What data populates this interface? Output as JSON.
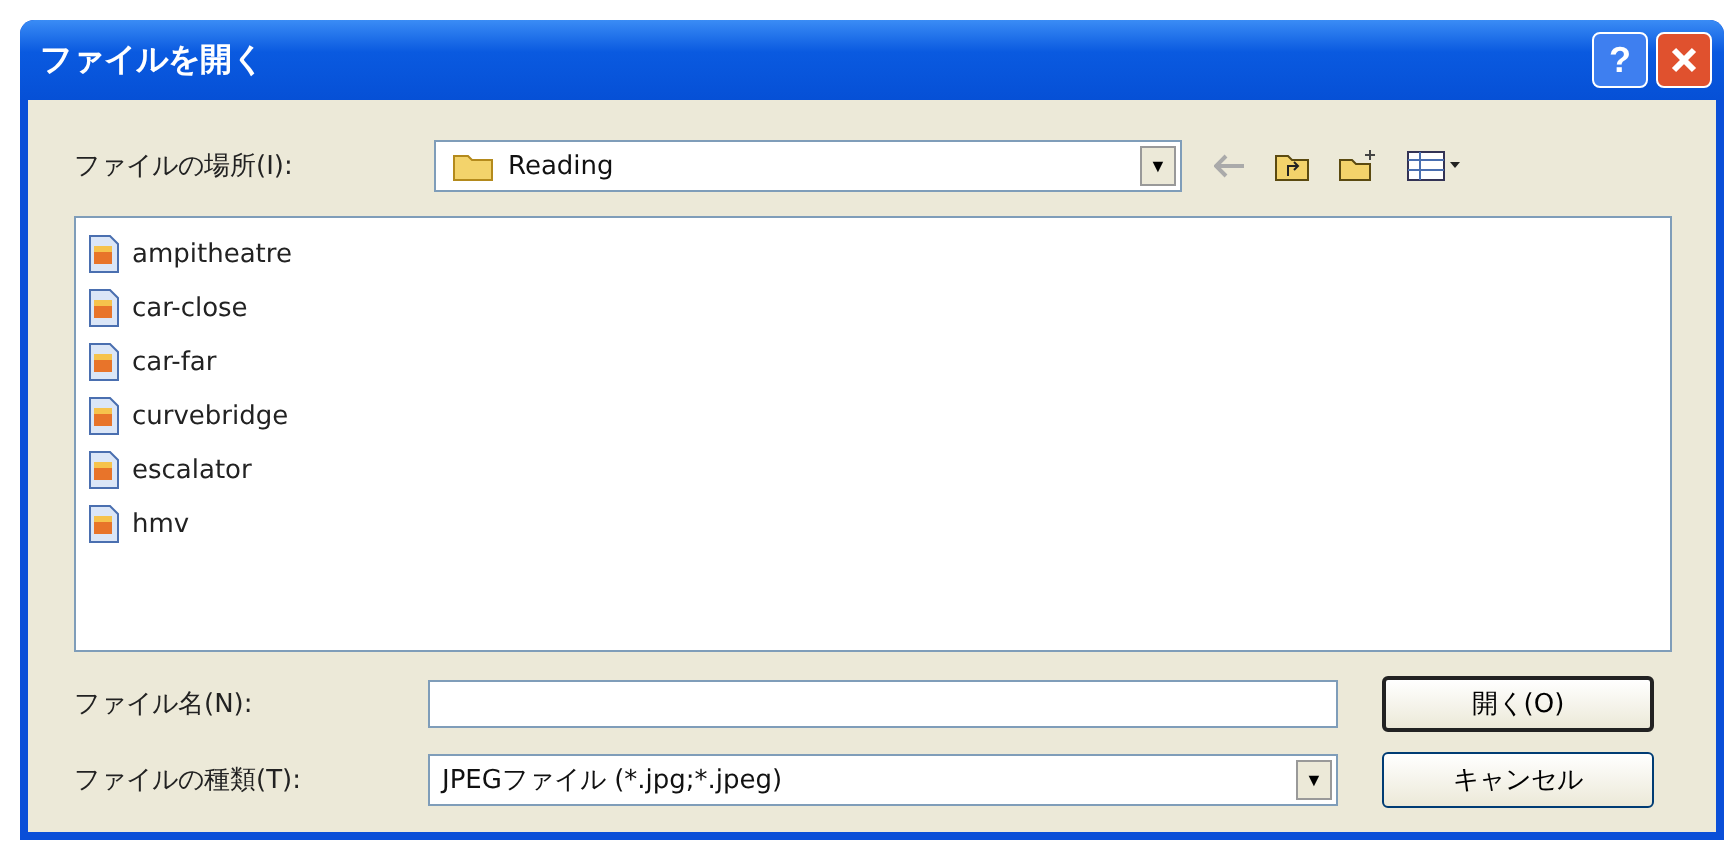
{
  "window": {
    "title": "ファイルを開く",
    "help_button": "?"
  },
  "location": {
    "label": "ファイルの場所(I):",
    "value": "Reading",
    "dropdown": "▼"
  },
  "files": [
    {
      "name": "ampitheatre"
    },
    {
      "name": "car-close"
    },
    {
      "name": "car-far"
    },
    {
      "name": "curvebridge"
    },
    {
      "name": "escalator"
    },
    {
      "name": "hmv"
    }
  ],
  "file_name": {
    "label": "ファイル名(N):"
  },
  "file_type": {
    "label": "ファイルの種類(T):",
    "value": "JPEGファイル (*.jpg;*.jpeg)",
    "dropdown": "▼"
  },
  "buttons": [
    {
      "label": "開く(O)",
      "default": true
    },
    {
      "label": "キャンセル",
      "default": false
    }
  ]
}
